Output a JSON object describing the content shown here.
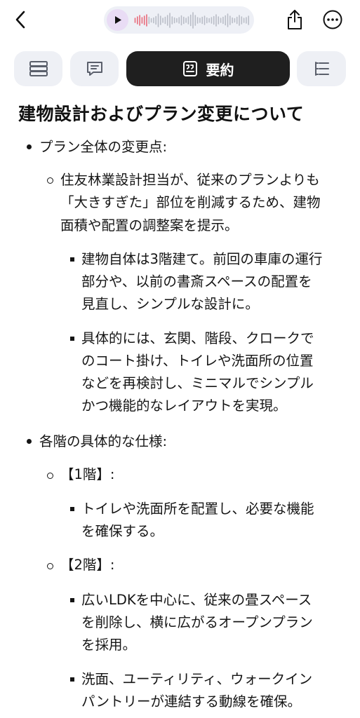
{
  "topbar": {
    "back_icon": "chevron-left-icon",
    "play_icon": "play-icon",
    "share_icon": "share-icon",
    "more_icon": "more-icon"
  },
  "tabs": [
    {
      "icon": "list-icon",
      "label": ""
    },
    {
      "icon": "chat-icon",
      "label": ""
    },
    {
      "icon": "summary-icon",
      "label": "要約",
      "active": true
    },
    {
      "icon": "outline-icon",
      "label": ""
    }
  ],
  "summary": {
    "title": "建物設計およびプラン変更について",
    "sections": [
      {
        "text": "プラン全体の変更点:",
        "items": [
          {
            "lines": [
              "住友林業設計担当が、従来のプランよりも",
              "「大きすぎた」部位を削減するため、建物",
              "面積や配置の調整案を提示。"
            ],
            "subitems": [
              {
                "lines": [
                  "建物自体は3階建て。前回の車庫の運行",
                  "部分や、以前の書斎スペースの配置を",
                  "見直し、シンプルな設計に。"
                ]
              },
              {
                "lines": [
                  "具体的には、玄関、階段、クロークで",
                  "のコート掛け、トイレや洗面所の位置",
                  "などを再検討し、ミニマルでシンプル",
                  "かつ機能的なレイアウトを実現。"
                ]
              }
            ]
          }
        ]
      },
      {
        "text": "各階の具体的な仕様:",
        "items": [
          {
            "lines": [
              "【1階】:"
            ],
            "subitems": [
              {
                "lines": [
                  "トイレや洗面所を配置し、必要な機能",
                  "を確保する。"
                ]
              }
            ]
          },
          {
            "lines": [
              "【2階】:"
            ],
            "subitems": [
              {
                "lines": [
                  "広いLDKを中心に、従来の畳スペース",
                  "を削除し、横に広がるオープンプラン",
                  "を採用。"
                ]
              },
              {
                "lines": [
                  "洗面、ユーティリティ、ウォークイン",
                  "パントリーが連結する動線を確保。"
                ]
              }
            ]
          }
        ]
      }
    ]
  },
  "colors": {
    "active_tab": "#1f1f1f",
    "tab_bg": "#eef0f5",
    "player_bg": "#eef0f6",
    "play_btn_bg": "#e9dcf5",
    "wave_played": "#e86a7a",
    "wave_unplayed": "#b9bdc7"
  }
}
